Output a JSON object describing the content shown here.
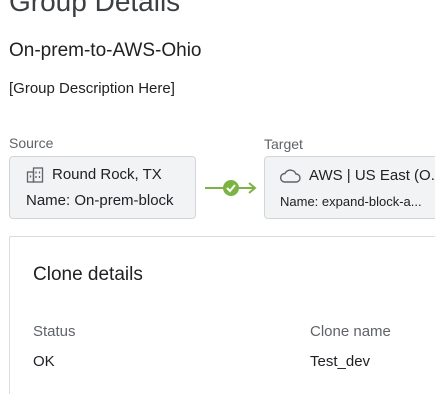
{
  "header": {
    "title": "Group Details",
    "group_name": "On-prem-to-AWS-Ohio",
    "group_description": "[Group Description Here]"
  },
  "source": {
    "label": "Source",
    "location": "Round Rock, TX",
    "name": "Name: On-prem-block",
    "icon": "building-icon"
  },
  "target": {
    "label": "Target",
    "location": "AWS | US East (O...",
    "name": "Name: expand-block-a...",
    "icon": "cloud-icon"
  },
  "connector": {
    "status": "ok",
    "color": "#7cb342"
  },
  "clone_details": {
    "title": "Clone details",
    "status_label": "Status",
    "status_value": "OK",
    "clone_name_label": "Clone name",
    "clone_name_value": "Test_dev"
  }
}
